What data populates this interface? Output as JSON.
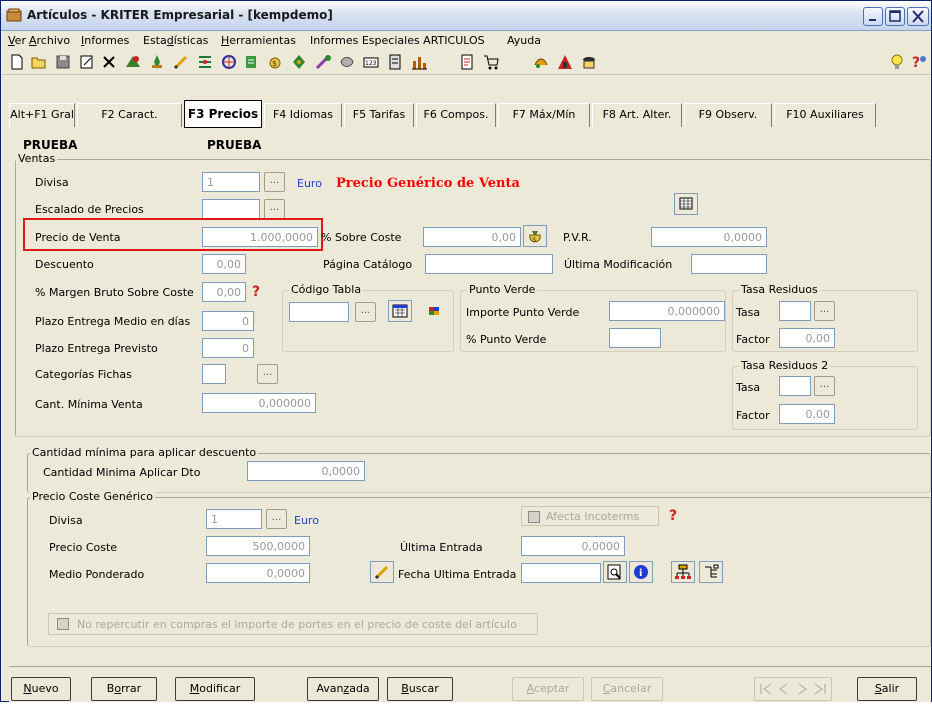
{
  "window": {
    "title": "Artículos - KRITER Empresarial - [kempdemo]"
  },
  "menu": [
    {
      "pre": "",
      "acc": "V",
      "post": "er"
    },
    {
      "pre": "",
      "acc": "A",
      "post": "rchivo"
    },
    {
      "pre": "",
      "acc": "I",
      "post": "nformes"
    },
    {
      "pre": "Esta",
      "acc": "d",
      "post": "ísticas"
    },
    {
      "pre": "",
      "acc": "H",
      "post": "erramientas"
    },
    {
      "pre": "Informes Especiales ARTICULOS",
      "acc": "",
      "post": ""
    },
    {
      "pre": "Ayuda",
      "acc": "",
      "post": ""
    }
  ],
  "tabs": [
    "Alt+F1 Gral",
    "F2 Caract.",
    "F3 Precios",
    "F4 Idiomas",
    "F5 Tarifas",
    "F6 Compos.",
    "F7 Máx/Mín",
    "F8 Art. Alter.",
    "F9 Observ.",
    "F10 Auxiliares"
  ],
  "header": {
    "code": "PRUEBA",
    "name": "PRUEBA"
  },
  "ventas": {
    "title": "Ventas",
    "divisa_label": "Divisa",
    "divisa_value": "1",
    "divisa_currency": "Euro",
    "precio_generico": "Precio Genérico de Venta",
    "escalado_label": "Escalado de Precios",
    "precio_venta_label": "Precio de Venta",
    "precio_venta_value": "1.000,0000",
    "sobre_coste_label": "% Sobre Coste",
    "sobre_coste_value": "0,00",
    "pvr_label": "P.V.R.",
    "pvr_value": "0,0000",
    "descuento_label": "Descuento",
    "descuento_value": "0,00",
    "pagina_catalogo_label": "Página Catálogo",
    "ultima_mod_label": "Última Modificación",
    "margen_label": "% Margen Bruto Sobre Coste",
    "margen_value": "0,00",
    "plazo_medio_label": "Plazo Entrega Medio en días",
    "plazo_medio_value": "0",
    "plazo_previsto_label": "Plazo Entrega Previsto",
    "plazo_previsto_value": "0",
    "categorias_label": "Categorías Fichas",
    "cant_minima_label": "Cant. Mínima Venta",
    "cant_minima_value": "0,000000"
  },
  "codigo_tabla": {
    "title": "Código Tabla"
  },
  "punto_verde": {
    "title": "Punto Verde",
    "importe_label": "Importe Punto Verde",
    "importe_value": "0,000000",
    "pct_label": "% Punto Verde"
  },
  "tasa_residuos": {
    "title": "Tasa Residuos",
    "tasa_label": "Tasa",
    "factor_label": "Factor",
    "factor_value": "0,00"
  },
  "tasa_residuos2": {
    "title": "Tasa Residuos 2",
    "tasa_label": "Tasa",
    "factor_label": "Factor",
    "factor_value": "0,00"
  },
  "descuento_min": {
    "title": "Cantidad mínima para aplicar descuento",
    "label": "Cantidad Minima Aplicar Dto",
    "value": "0,0000"
  },
  "coste": {
    "title": "Precio Coste Genérico",
    "divisa_label": "Divisa",
    "divisa_value": "1",
    "divisa_currency": "Euro",
    "afecta_label": "Afecta Incoterms",
    "precio_coste_label": "Precio Coste",
    "precio_coste_value": "500,0000",
    "ultima_entrada_label": "Última Entrada",
    "ultima_entrada_value": "0,0000",
    "medio_pond_label": "Medio Ponderado",
    "medio_pond_value": "0,0000",
    "fecha_label": "Fecha Ultima Entrada",
    "no_repercutir_label": "No repercutir en compras el importe de portes en el precio de coste del artículo"
  },
  "buttons": {
    "nuevo": {
      "acc": "N",
      "post": "uevo"
    },
    "borrar": {
      "pre": "B",
      "acc": "o",
      "post": "rrar"
    },
    "modificar": {
      "acc": "M",
      "post": "odificar"
    },
    "avanzada": {
      "pre": "Avan",
      "acc": "z",
      "post": "ada"
    },
    "buscar": {
      "acc": "B",
      "post": "uscar"
    },
    "aceptar": {
      "acc": "A",
      "post": "ceptar"
    },
    "cancelar": {
      "acc": "C",
      "post": "ancelar"
    },
    "salir": {
      "acc": "S",
      "post": "alir"
    }
  },
  "colors": {
    "accent_red": "#e01818",
    "link_blue": "#1c3fd1"
  }
}
